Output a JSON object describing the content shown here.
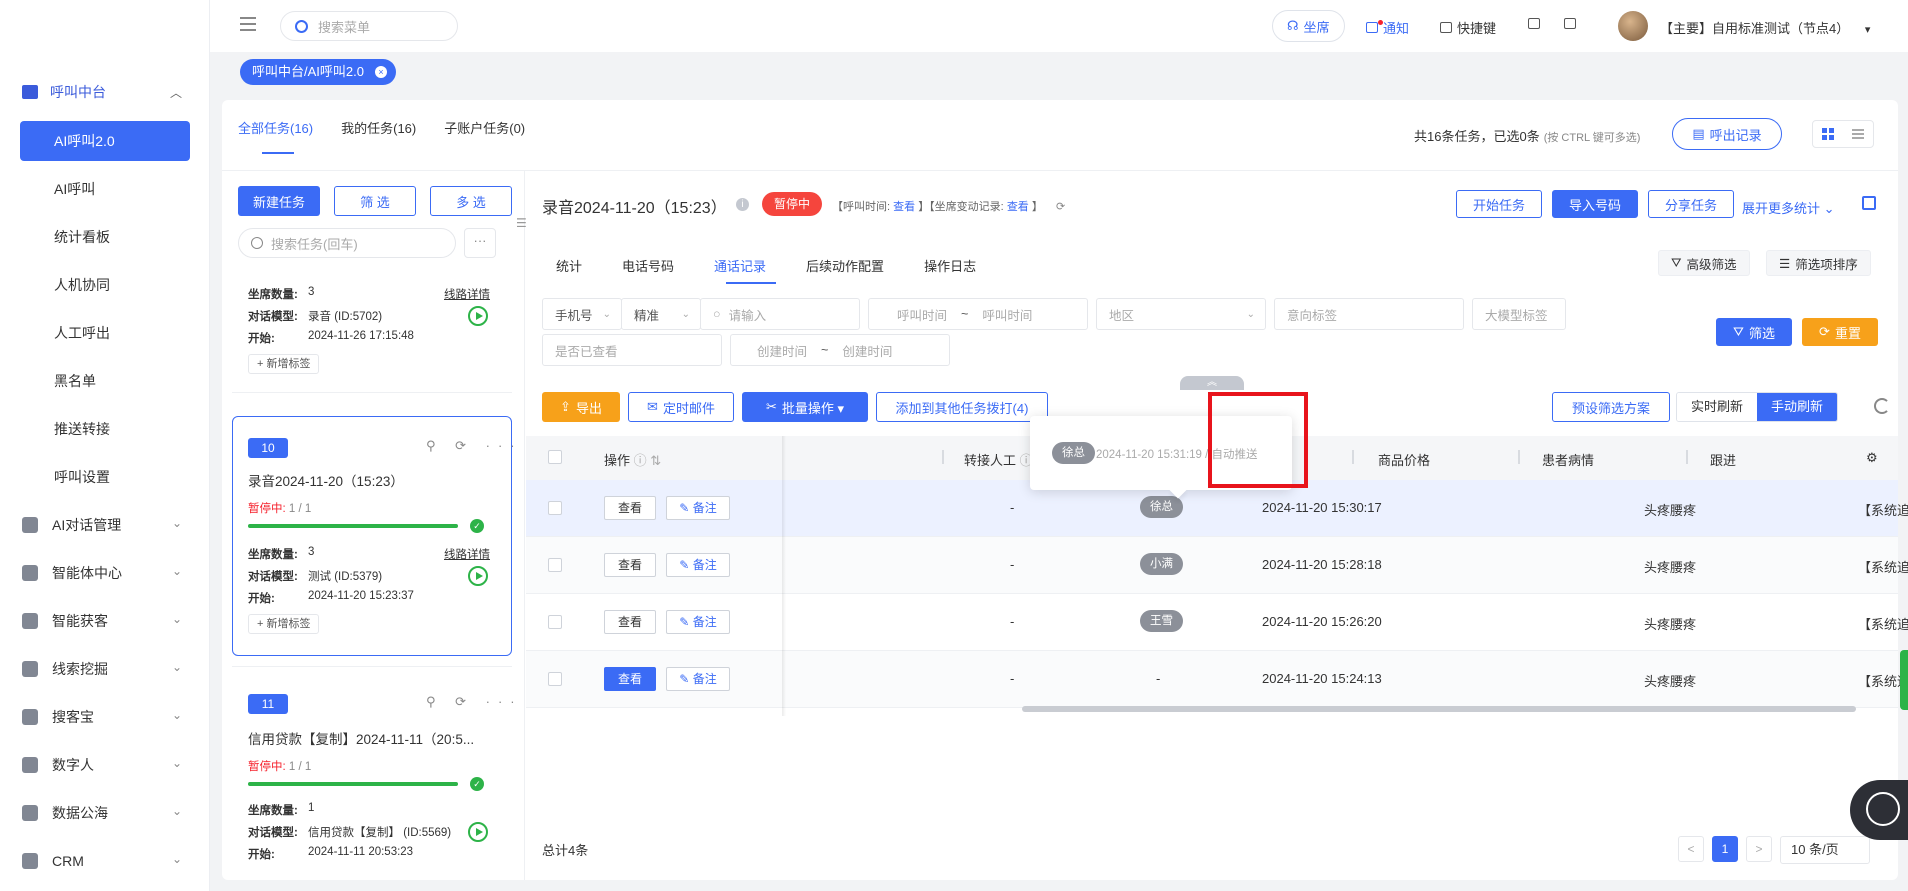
{
  "sidebar": {
    "top": {
      "label": "呼叫中台",
      "chevron": "︿"
    },
    "subitems": [
      {
        "label": "AI呼叫2.0",
        "active": true
      },
      {
        "label": "AI呼叫"
      },
      {
        "label": "统计看板"
      },
      {
        "label": "人机协同"
      },
      {
        "label": "人工呼出"
      },
      {
        "label": "黑名单"
      },
      {
        "label": "推送转接"
      },
      {
        "label": "呼叫设置"
      }
    ],
    "groups": [
      {
        "label": "AI对话管理",
        "icon": "book-icon"
      },
      {
        "label": "智能体中心",
        "icon": "agent-icon"
      },
      {
        "label": "智能获客",
        "icon": "search-icon"
      },
      {
        "label": "线索挖掘",
        "icon": "target-icon"
      },
      {
        "label": "搜客宝",
        "icon": "search-icon"
      },
      {
        "label": "数字人",
        "icon": "avatar-icon"
      },
      {
        "label": "数据公海",
        "icon": "chart-icon"
      },
      {
        "label": "CRM",
        "icon": "crm-icon"
      }
    ],
    "chevron": "⌄"
  },
  "topbar": {
    "search_placeholder": "搜索菜单",
    "seat_label": "坐席",
    "notify_label": "通知",
    "shortcut_label": "快捷键",
    "user_label": "【主要】自用标准测试（节点4）",
    "user_caret": "▾"
  },
  "tagbar": {
    "active_tag": "呼叫中台/AI呼叫2.0",
    "close": "×"
  },
  "main": {
    "tabs": [
      {
        "label": "全部任务(16)",
        "active": true
      },
      {
        "label": "我的任务(16)"
      },
      {
        "label": "子账户任务(0)"
      }
    ],
    "summary": "共16条任务，已选0条",
    "summary_hint": "(按 CTRL 键可多选)",
    "call_record_btn": "呼出记录",
    "new_task": "新建任务",
    "filter": "筛 选",
    "multi": "多 选",
    "task_search_placeholder": "搜索任务(回车)",
    "more": "···"
  },
  "tasks": {
    "card1": {
      "seats_label": "坐席数量:",
      "seats": "3",
      "model_label": "对话模型:",
      "model": "录音 (ID:5702)",
      "start_label": "开始:",
      "start": "2024-11-26 17:15:48",
      "trace": "线路详情",
      "add_tag": "+ 新增标签"
    },
    "card2": {
      "num": "10",
      "title": "录音2024-11-20（15:23）",
      "status": "暂停中:",
      "progress": "1 / 1",
      "progress_pct": 100,
      "seats_label": "坐席数量:",
      "seats": "3",
      "model_label": "对话模型:",
      "model": "测试 (ID:5379)",
      "start_label": "开始:",
      "start": "2024-11-20 15:23:37",
      "trace": "线路详情",
      "add_tag": "+ 新增标签"
    },
    "card3": {
      "num": "11",
      "title": "信用贷款【复制】2024-11-11（20:5...",
      "status": "暂停中:",
      "progress": "1 / 1",
      "progress_pct": 100,
      "seats_label": "坐席数量:",
      "seats": "1",
      "model_label": "对话模型:",
      "model": "信用贷款【复制】 (ID:5569)",
      "start_label": "开始:",
      "start": "2024-11-11 20:53:23"
    },
    "card_icons": "⚲ ⟳ ···"
  },
  "detail": {
    "title": "录音2024-11-20（15:23）",
    "info": "i",
    "status": "暂停中",
    "meta_call_time": "【呼叫时间:",
    "meta_view1": "查看",
    "meta_seat_change": "】【坐席变动记录:",
    "meta_view2": "查看",
    "meta_end": "】",
    "btn_start": "开始任务",
    "btn_import": "导入号码",
    "btn_share": "分享任务",
    "more_stats": "展开更多统计 ⌄",
    "subtabs": [
      {
        "label": "统计"
      },
      {
        "label": "电话号码"
      },
      {
        "label": "通话记录",
        "active": true
      },
      {
        "label": "后续动作配置"
      },
      {
        "label": "操作日志"
      }
    ],
    "adv_filter": "高级筛选",
    "filter_sort": "筛选项排序",
    "filters": {
      "phone": "手机号",
      "exact": "精准",
      "input_placeholder": "请输入",
      "call_time_start": "呼叫时间",
      "tilde": "~",
      "call_time_end": "呼叫时间",
      "region": "地区",
      "intent_tag": "意向标签",
      "llm_tag": "大模型标签",
      "viewed": "是否已查看",
      "create_start": "创建时间",
      "create_end": "创建时间",
      "btn_filter": "筛选",
      "btn_reset": "重置"
    },
    "actions": {
      "export": "导出",
      "schedule_mail": "定时邮件",
      "batch": "批量操作 ▾",
      "add_other": "添加到其他任务拨打(4)",
      "preset": "预设筛选方案",
      "realtime": "实时刷新",
      "manual": "手动刷新",
      "collapse": "︽"
    },
    "table": {
      "headers": {
        "op": "操作",
        "transfer": "转接人工",
        "time_suffix": "间",
        "price": "商品价格",
        "illness": "患者病情",
        "follow": "跟进"
      },
      "view": "查看",
      "note": "备注",
      "rows": [
        {
          "transfer": "-",
          "agent": "徐总",
          "time": "2024-11-20 15:30:17",
          "illness": "头疼腰疼",
          "follow": "【系统追"
        },
        {
          "transfer": "-",
          "agent": "小满",
          "time": "2024-11-20 15:28:18",
          "illness": "头疼腰疼",
          "follow": "【系统追"
        },
        {
          "transfer": "-",
          "agent": "王雪",
          "time": "2024-11-20 15:26:20",
          "illness": "头疼腰疼",
          "follow": "【系统追"
        },
        {
          "transfer": "-",
          "agent": "-",
          "time": "2024-11-20 15:24:13",
          "illness": "头疼腰疼",
          "follow": "【系统追"
        }
      ]
    },
    "popover": {
      "agent": "徐总",
      "text": "2024-11-20 15:31:19  /  自动推送"
    },
    "total": "总计4条",
    "page_prev": "<",
    "page": "1",
    "page_next": ">",
    "page_size": "10 条/页"
  },
  "colors": {
    "accent": "#3b6bf5",
    "danger": "#f5453d",
    "warning": "#f7a11a",
    "success": "#2db348"
  }
}
